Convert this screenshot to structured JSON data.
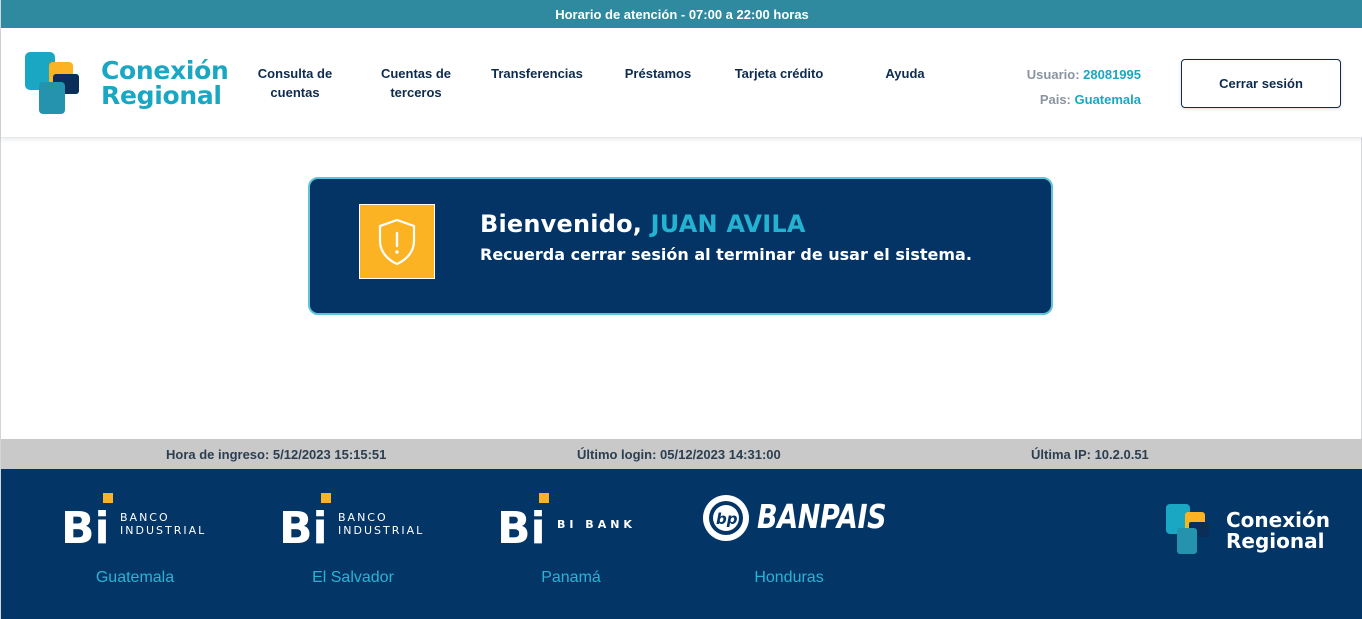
{
  "top_strip": {
    "text": "Horario de atención - 07:00 a 22:00 horas"
  },
  "header": {
    "logo": {
      "line1": "Conexión",
      "line2": "Regional"
    },
    "nav": [
      {
        "line1": "Consulta de",
        "line2": "cuentas"
      },
      {
        "line1": "Cuentas de",
        "line2": "terceros"
      },
      {
        "line1": "Transferencias",
        "line2": ""
      },
      {
        "line1": "Préstamos",
        "line2": ""
      },
      {
        "line1": "Tarjeta crédito",
        "line2": ""
      },
      {
        "line1": "Ayuda",
        "line2": ""
      }
    ],
    "user": {
      "label": "Usuario:",
      "value": "28081995"
    },
    "country": {
      "label": "Pais:",
      "value": "Guatemala"
    },
    "logout_label": "Cerrar sesión"
  },
  "welcome": {
    "greeting": "Bienvenido,",
    "name": "JUAN AVILA",
    "message": "Recuerda cerrar sesión al terminar de usar el sistema.",
    "icon": "shield-alert-icon"
  },
  "info_bar": {
    "login_time": "Hora de ingreso: 5/12/2023 15:15:51",
    "last_login": "Último login: 05/12/2023 14:31:00",
    "last_ip": "Última IP: 10.2.0.51"
  },
  "footer": {
    "banks": [
      {
        "brand_line1": "BANCO",
        "brand_line2": "INDUSTRIAL",
        "country": "Guatemala",
        "icon": "bi-logo-icon"
      },
      {
        "brand_line1": "BANCO",
        "brand_line2": "INDUSTRIAL",
        "country": "El Salvador",
        "icon": "bi-logo-icon"
      },
      {
        "brand_line1": "BI  BANK",
        "brand_line2": "",
        "country": "Panamá",
        "icon": "bi-logo-icon"
      },
      {
        "brand_line1": "BANPAIS",
        "brand_line2": "",
        "country": "Honduras",
        "icon": "banpais-logo-icon"
      }
    ],
    "logo": {
      "line1": "Conexión",
      "line2": "Regional"
    }
  },
  "colors": {
    "brand_dark": "#043466",
    "brand_cyan": "#1aa7c4",
    "accent_yellow": "#fbb324",
    "strip_teal": "#2f8aa0"
  }
}
